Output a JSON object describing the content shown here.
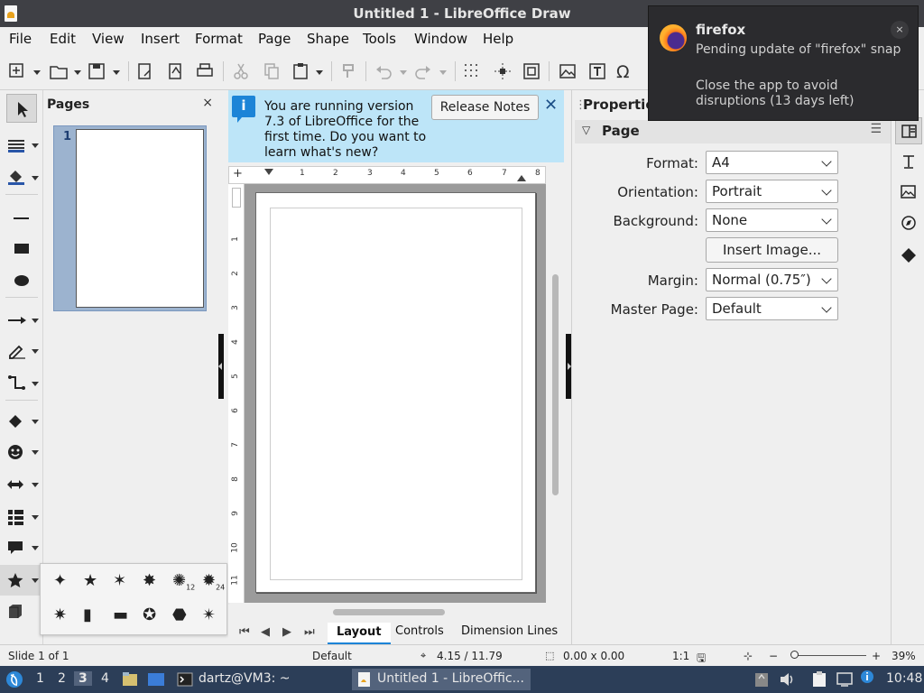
{
  "window": {
    "title": "Untitled 1 - LibreOffice Draw"
  },
  "menu": {
    "items": [
      "File",
      "Edit",
      "View",
      "Insert",
      "Format",
      "Page",
      "Shape",
      "Tools",
      "Window",
      "Help"
    ]
  },
  "pages_panel": {
    "title": "Pages",
    "close": "×",
    "pages": [
      {
        "number": "1"
      }
    ]
  },
  "infobar": {
    "message": "You are running version 7.3 of LibreOffice for the first time. Do you want to learn what's new?",
    "button": "Release Notes",
    "close": "✕",
    "icon": "i"
  },
  "ruler": {
    "horizontal": [
      "1",
      "2",
      "3",
      "4",
      "5",
      "6",
      "7",
      "8"
    ],
    "vertical": [
      "1",
      "2",
      "3",
      "4",
      "5",
      "6",
      "7",
      "8",
      "9",
      "10",
      "11"
    ]
  },
  "tabs": {
    "nav": [
      "⏮",
      "◀",
      "▶",
      "⏭"
    ],
    "items": [
      "Layout",
      "Controls",
      "Dimension Lines"
    ],
    "active": "Layout"
  },
  "properties": {
    "title": "Properties",
    "section": "Page",
    "rows": [
      {
        "label": "Format:",
        "value": "A4"
      },
      {
        "label": "Orientation:",
        "value": "Portrait"
      },
      {
        "label": "Background:",
        "value": "None"
      },
      {
        "label": "Margin:",
        "value": "Normal (0.75″)"
      },
      {
        "label": "Master Page:",
        "value": "Default"
      }
    ],
    "insert_image": "Insert Image..."
  },
  "notification": {
    "app": "firefox",
    "line1": "Pending update of \"firefox\" snap",
    "line2": "Close the app to avoid disruptions (13 days left)",
    "close": "×"
  },
  "statusbar": {
    "slide": "Slide 1 of 1",
    "master": "Default",
    "position": "4.15 / 11.79",
    "size": "0.00 x 0.00",
    "scale": "1:1",
    "zoom_minus": "−",
    "zoom_plus": "+",
    "zoom": "39%"
  },
  "taskbar": {
    "workspaces": [
      "1",
      "2",
      "3",
      "4"
    ],
    "active_workspace": "3",
    "tasks": [
      "dartz@VM3: ~",
      "Untitled 1 - LibreOffic..."
    ],
    "clock": "10:48"
  },
  "shapes_popup": {
    "labels": [
      "12",
      "24"
    ]
  },
  "colors": {
    "accent": "#1c84d7",
    "infobar": "#bde5f8",
    "taskbar": "#2c3e58",
    "titlebar": "#3f4045"
  }
}
